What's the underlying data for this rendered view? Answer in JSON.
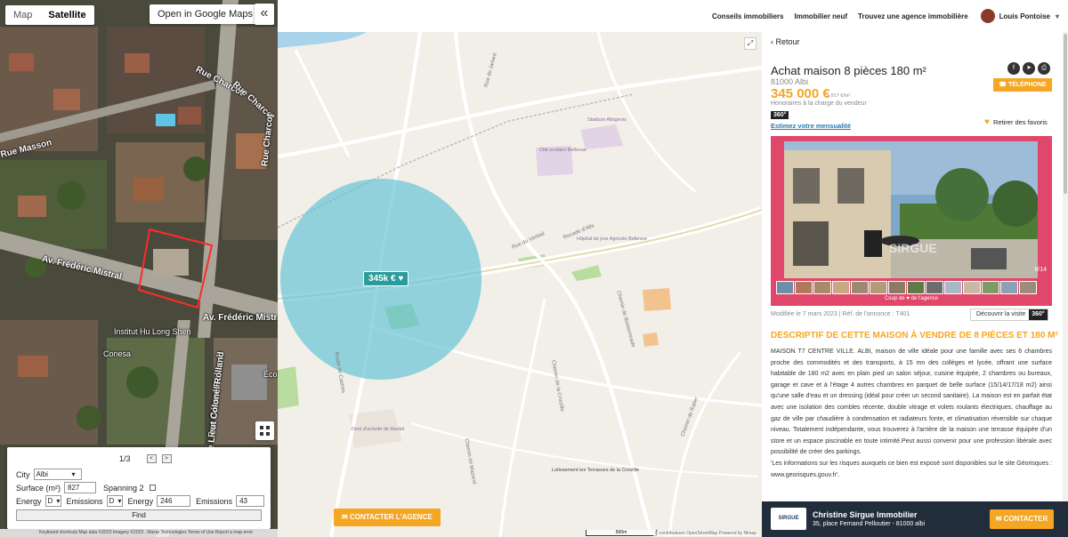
{
  "map_left": {
    "type_map": "Map",
    "type_satellite": "Satellite",
    "open_google_maps": "Open in Google Maps",
    "collapse_glyph": "«",
    "roads": [
      "Rue Charcot",
      "Rue Charcot",
      "Rue Charcot",
      "Av. Frédéric Mistral",
      "Av. Frédéric Mistral",
      "Rue Masson",
      "Rue Gérard Rolland",
      "Rue Lieut Colonel Rolland"
    ],
    "pois": [
      "Institut Hu Long Shen",
      "Conesa",
      "Écol"
    ],
    "attribution": "Keyboard shortcuts   Map data ©2023 Imagery ©2023 , Maxar Technologies   Terms of Use   Report a map error",
    "parcel_color": "#ff2a2a"
  },
  "panel": {
    "pager": "1/3",
    "prev": "<",
    "next": ">",
    "city_label": "City",
    "city_value": "Albi",
    "surface_label": "Surface (m²)",
    "surface_value": "827",
    "spanning_label": "Spanning 2",
    "energy_label": "Energy",
    "energy_value": "D",
    "emissions_label": "Emissions",
    "emissions_value": "D",
    "energy2_label": "Energy",
    "energy2_value": "246",
    "emissions2_label": "Emissions",
    "emissions2_value": "43",
    "find": "Find"
  },
  "header": {
    "nav": [
      "Conseils immobiliers",
      "Immobilier neuf",
      "Trouvez une agence immobilière"
    ],
    "user": "Louis Pontoise"
  },
  "streetmap": {
    "price_pin": "345k € ♥",
    "contact_agency": "CONTACTER L'AGENCE",
    "scale": "500m",
    "attribution": "© contributeurs OpenStreetMap   Powered by Nimap",
    "pois": [
      "Cité scolaire Bellevue",
      "Stadium Albigeois",
      "Hôpital de jour Agricole Bellevue",
      "Zone d'activité de Rantel",
      "Lotissement les Terrasses de la Croizille"
    ],
    "roads": [
      "Rocade d'Albi",
      "Rue du Verbial",
      "Route de Castres",
      "Chemin de la Croizille",
      "Chemin de Boissonnade",
      "Rue de Jarlard",
      "Chemin de Mazerol",
      "Chemin de Ratier"
    ],
    "circle_color": "#5cc0d4"
  },
  "listing": {
    "back": "Retour",
    "title": "Achat maison 8 pièces 180 m²",
    "city": "81000 Albi",
    "price": "345 000 €",
    "price_per_m2": "1 917 €/m²",
    "fees": "Honoraires à la charge du vendeur",
    "badge": "360°",
    "estimate": "Estimez votre mensualité",
    "favorites": "Retirer des favoris",
    "phone": "TÉLÉPHONE",
    "social_icons": [
      "facebook-icon",
      "telegram-icon",
      "print-icon"
    ],
    "photo_counter": "8/14",
    "gallery_caption": "Coup de ♥ de l'agence",
    "watermark": "SIRGUE",
    "modified": "Modifiée le 7 mars 2023 | Réf. de l'annonce : T401",
    "decouvrir": "Découvrir la visite",
    "decouvrir_badge": "360°",
    "desc_title": "DESCRIPTIF DE CETTE MAISON À VENDRE DE 8 PIÈCES ET 180 M²",
    "desc_p1": "MAISON T7 CENTRE VILLE. ALBI, maison de ville idéale pour une famille avec ses 6 chambres proche des commodités et des transports, à 15 mn des collèges et lycée, offrant une surface habitable de 180 m2 avec en plain pied un salon séjour, cuisine équipée, 2 chambres ou bureaux, garage et cave et à l'étage 4 autres chambres en parquet de belle surface (15/14/17/18 m2) ainsi qu'une salle d'eau et un dressing (idéal pour créer un second sanitaire). La maison est en parfait état avec une isolation des combles récente, double vitrage et volets roulants électriques, chauffage au gaz de ville par chaudière à condensation et radiateurs fonte, et climatisation réversible sur chaque niveau. Totalement indépendante, vous trouverez à l'arrière de la maison une terrasse équipée d'un store et un espace piscinable en toute intimité.Peut aussi convenir pour une profession libérale avec possibilité de créer des parkings.",
    "desc_p2": "'Les informations sur les risques auxquels ce bien est exposé sont disponibles sur le site Géorisques : www.georisques.gouv.fr'.",
    "agency_logo": "SIRGUE",
    "agency_name": "Christine Sirgue Immobilier",
    "agency_address": "35, place Fernand Pelloutier - 81000 albi",
    "agency_contact": "CONTACTER",
    "accent_color": "#f5a623",
    "gallery_color": "#e0476a"
  }
}
